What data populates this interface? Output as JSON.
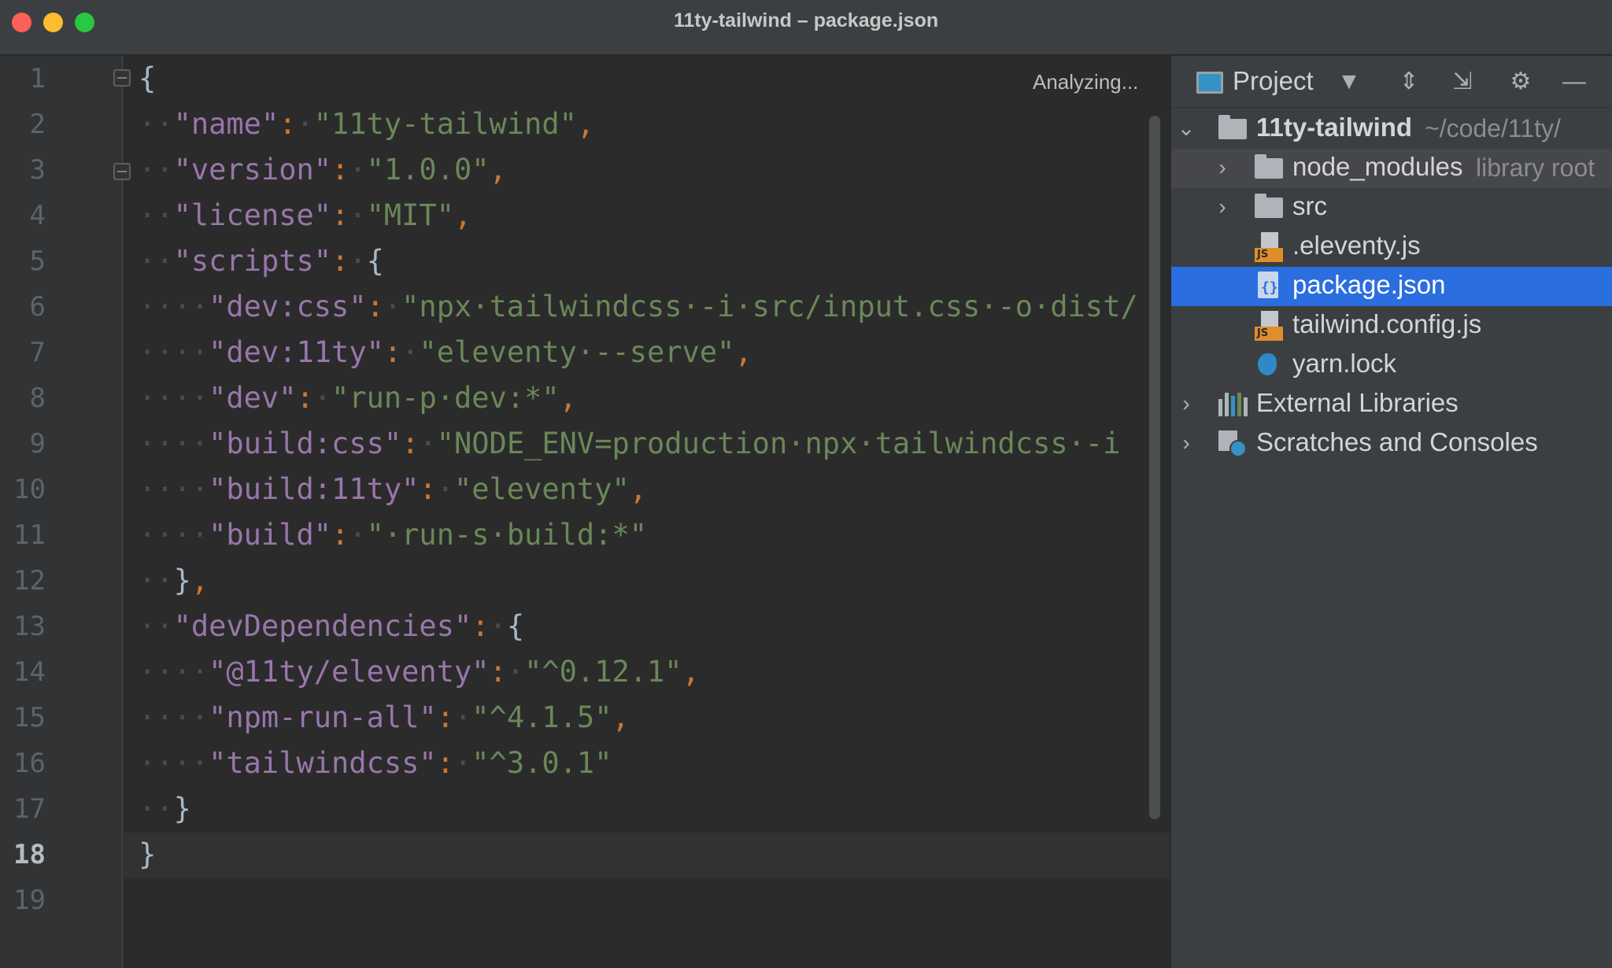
{
  "window": {
    "title": "11ty-tailwind – package.json"
  },
  "editor": {
    "status": "Analyzing...",
    "current_line": 18,
    "line_numbers": [
      "1",
      "2",
      "3",
      "4",
      "5",
      "6",
      "7",
      "8",
      "9",
      "10",
      "11",
      "12",
      "13",
      "14",
      "15",
      "16",
      "17",
      "18",
      "19"
    ],
    "lines": [
      [
        [
          "b",
          "{"
        ]
      ],
      [
        [
          "d",
          "··"
        ],
        [
          "k",
          "\"name\""
        ],
        [
          "p",
          ":"
        ],
        [
          "d",
          "·"
        ],
        [
          "s",
          "\"11ty-tailwind\""
        ],
        [
          "p",
          ","
        ]
      ],
      [
        [
          "d",
          "··"
        ],
        [
          "k",
          "\"version\""
        ],
        [
          "p",
          ":"
        ],
        [
          "d",
          "·"
        ],
        [
          "s",
          "\"1.0.0\""
        ],
        [
          "p",
          ","
        ]
      ],
      [
        [
          "d",
          "··"
        ],
        [
          "k",
          "\"license\""
        ],
        [
          "p",
          ":"
        ],
        [
          "d",
          "·"
        ],
        [
          "s",
          "\"MIT\""
        ],
        [
          "p",
          ","
        ]
      ],
      [
        [
          "d",
          "··"
        ],
        [
          "k",
          "\"scripts\""
        ],
        [
          "p",
          ":"
        ],
        [
          "d",
          "·"
        ],
        [
          "b",
          "{"
        ]
      ],
      [
        [
          "d",
          "····"
        ],
        [
          "k",
          "\"dev:css\""
        ],
        [
          "p",
          ":"
        ],
        [
          "d",
          "·"
        ],
        [
          "s",
          "\"npx·tailwindcss·-i·src/input.css·-o·dist/"
        ]
      ],
      [
        [
          "d",
          "····"
        ],
        [
          "k",
          "\"dev:11ty\""
        ],
        [
          "p",
          ":"
        ],
        [
          "d",
          "·"
        ],
        [
          "s",
          "\"eleventy·--serve\""
        ],
        [
          "p",
          ","
        ]
      ],
      [
        [
          "d",
          "····"
        ],
        [
          "k",
          "\"dev\""
        ],
        [
          "p",
          ":"
        ],
        [
          "d",
          "·"
        ],
        [
          "s",
          "\"run-p·dev:*\""
        ],
        [
          "p",
          ","
        ]
      ],
      [
        [
          "d",
          "····"
        ],
        [
          "k",
          "\"build:css\""
        ],
        [
          "p",
          ":"
        ],
        [
          "d",
          "·"
        ],
        [
          "s",
          "\"NODE_ENV=production·npx·tailwindcss·-i"
        ]
      ],
      [
        [
          "d",
          "····"
        ],
        [
          "k",
          "\"build:11ty\""
        ],
        [
          "p",
          ":"
        ],
        [
          "d",
          "·"
        ],
        [
          "s",
          "\"eleventy\""
        ],
        [
          "p",
          ","
        ]
      ],
      [
        [
          "d",
          "····"
        ],
        [
          "k",
          "\"build\""
        ],
        [
          "p",
          ":"
        ],
        [
          "d",
          "·"
        ],
        [
          "s",
          "\"·run-s·build:*\""
        ]
      ],
      [
        [
          "d",
          "··"
        ],
        [
          "b",
          "}"
        ],
        [
          "p",
          ","
        ]
      ],
      [
        [
          "d",
          "··"
        ],
        [
          "k",
          "\"devDependencies\""
        ],
        [
          "p",
          ":"
        ],
        [
          "d",
          "·"
        ],
        [
          "b",
          "{"
        ]
      ],
      [
        [
          "d",
          "····"
        ],
        [
          "k",
          "\"@11ty/eleventy\""
        ],
        [
          "p",
          ":"
        ],
        [
          "d",
          "·"
        ],
        [
          "s",
          "\"^0.12.1\""
        ],
        [
          "p",
          ","
        ]
      ],
      [
        [
          "d",
          "····"
        ],
        [
          "k",
          "\"npm-run-all\""
        ],
        [
          "p",
          ":"
        ],
        [
          "d",
          "·"
        ],
        [
          "s",
          "\"^4.1.5\""
        ],
        [
          "p",
          ","
        ]
      ],
      [
        [
          "d",
          "····"
        ],
        [
          "k",
          "\"tailwindcss\""
        ],
        [
          "p",
          ":"
        ],
        [
          "d",
          "·"
        ],
        [
          "s",
          "\"^3.0.1\""
        ]
      ],
      [
        [
          "d",
          "··"
        ],
        [
          "b",
          "}"
        ]
      ],
      [
        [
          "b",
          "}"
        ]
      ],
      []
    ]
  },
  "project_panel": {
    "title": "Project",
    "icons": {
      "dropdown": "chevron-down-icon",
      "expand_all": "expand-all-icon",
      "collapse_all": "collapse-all-icon",
      "settings": "gear-icon",
      "hide": "minimize-icon"
    },
    "tree": [
      {
        "name": "11ty-tailwind",
        "hint": "~/code/11ty/",
        "type": "folder",
        "level": 0,
        "expanded": true,
        "bold": true
      },
      {
        "name": "node_modules",
        "hint": "library root",
        "type": "folder",
        "level": 1,
        "expanded": false,
        "highlighted": true
      },
      {
        "name": "src",
        "hint": "",
        "type": "folder",
        "level": 1,
        "expanded": false
      },
      {
        "name": ".eleventy.js",
        "hint": "",
        "type": "js",
        "level": 1
      },
      {
        "name": "package.json",
        "hint": "",
        "type": "json",
        "level": 1,
        "selected": true
      },
      {
        "name": "tailwind.config.js",
        "hint": "",
        "type": "js",
        "level": 1
      },
      {
        "name": "yarn.lock",
        "hint": "",
        "type": "yarn",
        "level": 1
      },
      {
        "name": "External Libraries",
        "hint": "",
        "type": "libraries",
        "level": 0,
        "expanded": false
      },
      {
        "name": "Scratches and Consoles",
        "hint": "",
        "type": "scratches",
        "level": 0,
        "expanded": false
      }
    ]
  },
  "colors": {
    "key": "#9876aa",
    "string": "#6a8759",
    "punctuation": "#cc7832",
    "selection": "#2a6ee0"
  }
}
